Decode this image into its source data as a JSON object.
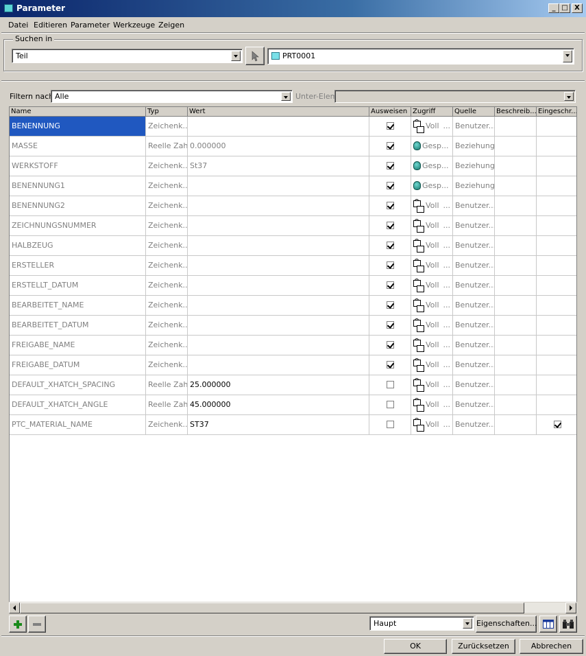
{
  "window": {
    "title": "Parameter",
    "minimize": "_",
    "maximize": "□",
    "close": "X"
  },
  "menu": [
    "Datei",
    "Editieren",
    "Parameter",
    "Werkzeuge",
    "Zeigen"
  ],
  "search": {
    "legend": "Suchen in",
    "scope_value": "Teil",
    "object_value": "PRT0001"
  },
  "filter": {
    "label": "Filtern nach",
    "value": "Alle",
    "sub_label": "Unter-Elem",
    "sub_value": ""
  },
  "table": {
    "headers": [
      "Name",
      "Typ",
      "Wert",
      "Ausweisen",
      "Zugriff",
      "Quelle",
      "Beschreib...",
      "Eingeschr..."
    ],
    "rows": [
      {
        "name": "BENENNUNG",
        "typ": "Zeichenk...",
        "wert": "",
        "ausweisen": true,
        "zugriff_icon": "lock-icon",
        "zugriff": "Voll",
        "zugriff_more": "...",
        "quelle": "Benutzer...",
        "beschreib": "",
        "eingeschr": false,
        "selected": true,
        "wert_dark": false
      },
      {
        "name": "MASSE",
        "typ": "Reelle Zahl",
        "wert": "0.000000",
        "ausweisen": true,
        "zugriff_icon": "shield-icon",
        "zugriff": "Gesp...",
        "zugriff_more": "",
        "quelle": "Beziehung",
        "beschreib": "",
        "eingeschr": false,
        "selected": false,
        "wert_dark": false
      },
      {
        "name": "WERKSTOFF",
        "typ": "Zeichenk...",
        "wert": "St37",
        "ausweisen": true,
        "zugriff_icon": "shield-icon",
        "zugriff": "Gesp...",
        "zugriff_more": "",
        "quelle": "Beziehung",
        "beschreib": "",
        "eingeschr": false,
        "selected": false,
        "wert_dark": false
      },
      {
        "name": "BENENNUNG1",
        "typ": "Zeichenk...",
        "wert": "",
        "ausweisen": true,
        "zugriff_icon": "shield-icon",
        "zugriff": "Gesp...",
        "zugriff_more": "",
        "quelle": "Beziehung",
        "beschreib": "",
        "eingeschr": false,
        "selected": false,
        "wert_dark": false
      },
      {
        "name": "BENENNUNG2",
        "typ": "Zeichenk...",
        "wert": "",
        "ausweisen": true,
        "zugriff_icon": "lock-icon",
        "zugriff": "Voll",
        "zugriff_more": "...",
        "quelle": "Benutzer...",
        "beschreib": "",
        "eingeschr": false,
        "selected": false,
        "wert_dark": false
      },
      {
        "name": "ZEICHNUNGSNUMMER",
        "typ": "Zeichenk...",
        "wert": "",
        "ausweisen": true,
        "zugriff_icon": "lock-icon",
        "zugriff": "Voll",
        "zugriff_more": "...",
        "quelle": "Benutzer...",
        "beschreib": "",
        "eingeschr": false,
        "selected": false,
        "wert_dark": false
      },
      {
        "name": "HALBZEUG",
        "typ": "Zeichenk...",
        "wert": "",
        "ausweisen": true,
        "zugriff_icon": "lock-icon",
        "zugriff": "Voll",
        "zugriff_more": "...",
        "quelle": "Benutzer...",
        "beschreib": "",
        "eingeschr": false,
        "selected": false,
        "wert_dark": false
      },
      {
        "name": "ERSTELLER",
        "typ": "Zeichenk...",
        "wert": "",
        "ausweisen": true,
        "zugriff_icon": "lock-icon",
        "zugriff": "Voll",
        "zugriff_more": "...",
        "quelle": "Benutzer...",
        "beschreib": "",
        "eingeschr": false,
        "selected": false,
        "wert_dark": false
      },
      {
        "name": "ERSTELLT_DATUM",
        "typ": "Zeichenk...",
        "wert": "",
        "ausweisen": true,
        "zugriff_icon": "lock-icon",
        "zugriff": "Voll",
        "zugriff_more": "...",
        "quelle": "Benutzer...",
        "beschreib": "",
        "eingeschr": false,
        "selected": false,
        "wert_dark": false
      },
      {
        "name": "BEARBEITET_NAME",
        "typ": "Zeichenk...",
        "wert": "",
        "ausweisen": true,
        "zugriff_icon": "lock-icon",
        "zugriff": "Voll",
        "zugriff_more": "...",
        "quelle": "Benutzer...",
        "beschreib": "",
        "eingeschr": false,
        "selected": false,
        "wert_dark": false
      },
      {
        "name": "BEARBEITET_DATUM",
        "typ": "Zeichenk...",
        "wert": "",
        "ausweisen": true,
        "zugriff_icon": "lock-icon",
        "zugriff": "Voll",
        "zugriff_more": "...",
        "quelle": "Benutzer...",
        "beschreib": "",
        "eingeschr": false,
        "selected": false,
        "wert_dark": false
      },
      {
        "name": "FREIGABE_NAME",
        "typ": "Zeichenk...",
        "wert": "",
        "ausweisen": true,
        "zugriff_icon": "lock-icon",
        "zugriff": "Voll",
        "zugriff_more": "...",
        "quelle": "Benutzer...",
        "beschreib": "",
        "eingeschr": false,
        "selected": false,
        "wert_dark": false
      },
      {
        "name": "FREIGABE_DATUM",
        "typ": "Zeichenk...",
        "wert": "",
        "ausweisen": true,
        "zugriff_icon": "lock-icon",
        "zugriff": "Voll",
        "zugriff_more": "...",
        "quelle": "Benutzer...",
        "beschreib": "",
        "eingeschr": false,
        "selected": false,
        "wert_dark": false
      },
      {
        "name": "DEFAULT_XHATCH_SPACING",
        "typ": "Reelle Zahl",
        "wert": "25.000000",
        "ausweisen": false,
        "zugriff_icon": "lock-icon",
        "zugriff": "Voll",
        "zugriff_more": "...",
        "quelle": "Benutzer...",
        "beschreib": "",
        "eingeschr": false,
        "selected": false,
        "wert_dark": true
      },
      {
        "name": "DEFAULT_XHATCH_ANGLE",
        "typ": "Reelle Zahl",
        "wert": "45.000000",
        "ausweisen": false,
        "zugriff_icon": "lock-icon",
        "zugriff": "Voll",
        "zugriff_more": "...",
        "quelle": "Benutzer...",
        "beschreib": "",
        "eingeschr": false,
        "selected": false,
        "wert_dark": true
      },
      {
        "name": "PTC_MATERIAL_NAME",
        "typ": "Zeichenk...",
        "wert": "ST37",
        "ausweisen": false,
        "zugriff_icon": "lock-icon",
        "zugriff": "Voll",
        "zugriff_more": "...",
        "quelle": "Benutzer...",
        "beschreib": "",
        "eingeschr": true,
        "selected": false,
        "wert_dark": true
      }
    ]
  },
  "bottom": {
    "add_icon": "plus-icon",
    "remove_icon": "minus-icon",
    "view_value": "Haupt",
    "properties_label": "Eigenschaften...",
    "columns_icon": "table-columns-icon",
    "search_icon": "binoculars-icon"
  },
  "dialog_buttons": {
    "ok": "OK",
    "reset": "Zurücksetzen",
    "cancel": "Abbrechen"
  },
  "colors": {
    "title_start": "#0a246a",
    "selection": "#2058c0",
    "face": "#d4d0c8"
  }
}
